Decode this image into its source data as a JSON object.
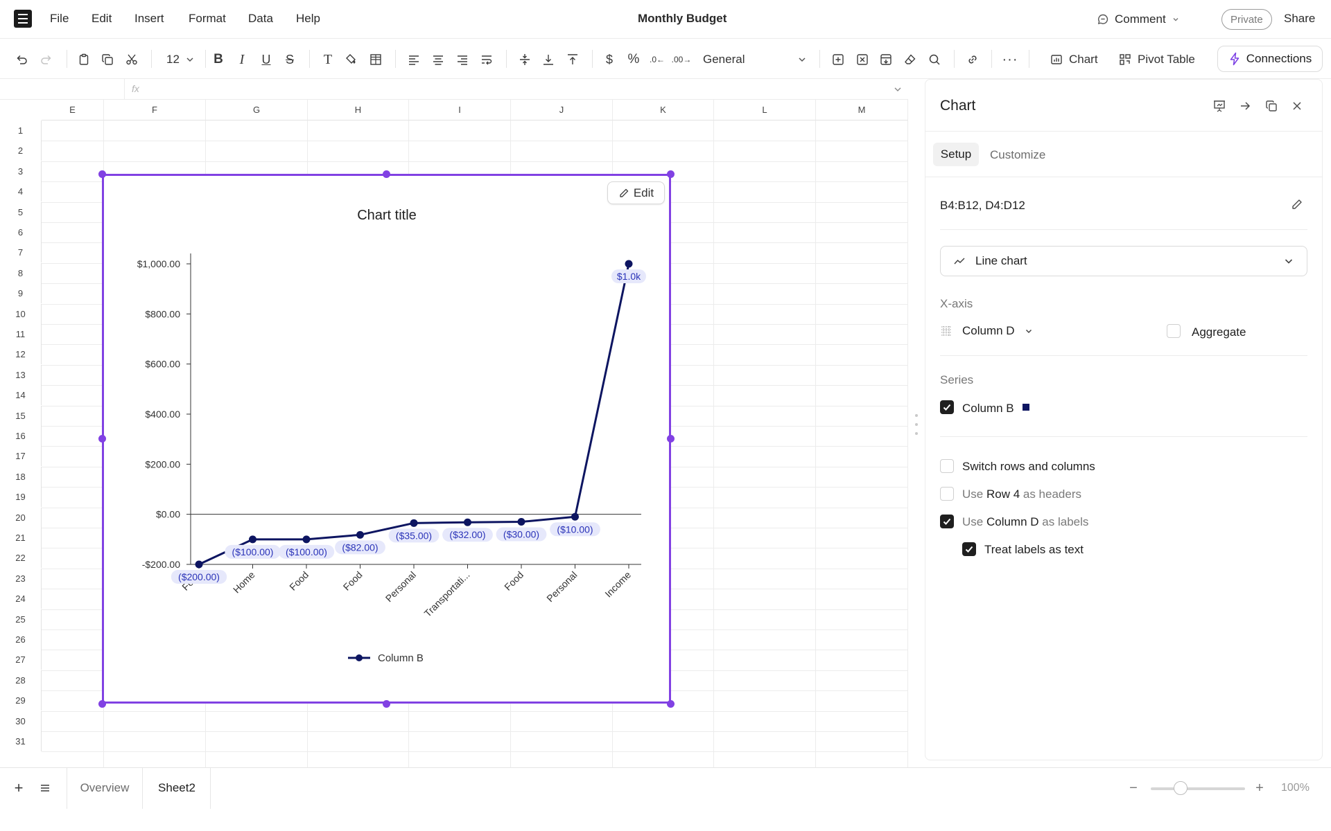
{
  "menu": {
    "items": [
      "File",
      "Edit",
      "Insert",
      "Format",
      "Data",
      "Help"
    ]
  },
  "document": {
    "title": "Monthly Budget"
  },
  "header": {
    "comment_label": "Comment",
    "private_label": "Private",
    "share_label": "Share"
  },
  "toolbar": {
    "font_size": "12",
    "number_format": "General",
    "chart_label": "Chart",
    "pivot_label": "Pivot Table",
    "connections_label": "Connections",
    "icons": [
      "undo-icon",
      "redo-icon",
      "paste-icon",
      "copy-icon",
      "cut-icon",
      "bold-icon",
      "italic-icon",
      "underline-icon",
      "strikethrough-icon",
      "clear-format-icon",
      "fill-color-icon",
      "borders-icon",
      "align-left-icon",
      "align-center-icon",
      "align-right-icon",
      "wrap-icon",
      "valign-middle-icon",
      "valign-bottom-icon",
      "valign-top-icon",
      "currency-icon",
      "percent-icon",
      "decrease-decimal-icon",
      "increase-decimal-icon",
      "insert-icon",
      "delete-icon",
      "freeze-icon",
      "eraser-icon",
      "search-icon",
      "link-icon",
      "more-icon"
    ]
  },
  "formula_bar": {
    "fx": "fx"
  },
  "grid": {
    "columns": [
      "E",
      "F",
      "G",
      "H",
      "I",
      "J",
      "K",
      "L",
      "M"
    ],
    "rows": [
      "1",
      "2",
      "3",
      "4",
      "5",
      "6",
      "7",
      "8",
      "9",
      "10",
      "11",
      "12",
      "13",
      "14",
      "15",
      "16",
      "17",
      "18",
      "19",
      "20",
      "21",
      "22",
      "23",
      "24",
      "25",
      "26",
      "27",
      "28",
      "29",
      "30",
      "31"
    ]
  },
  "chart_edit_label": "Edit",
  "chart_data": {
    "type": "line",
    "title": "Chart title",
    "categories": [
      "Food",
      "Home",
      "Food",
      "Food",
      "Personal",
      "Transportati...",
      "Food",
      "Personal",
      "Income"
    ],
    "series": [
      {
        "name": "Column B",
        "color": "#0d1561",
        "values": [
          -200,
          -100,
          -100,
          -82,
          -35,
          -32,
          -30,
          -10,
          1000
        ]
      }
    ],
    "data_labels": [
      "($200.00)",
      "($100.00)",
      "($100.00)",
      "($82.00)",
      "($35.00)",
      "($32.00)",
      "($30.00)",
      "($10.00)",
      "$1.0k"
    ],
    "y_ticks": [
      "$1,000.00",
      "$800.00",
      "$600.00",
      "$400.00",
      "$200.00",
      "$0.00",
      "-$200.00"
    ],
    "y_tick_values": [
      1000,
      800,
      600,
      400,
      200,
      0,
      -200
    ],
    "ylim": [
      -200,
      1000
    ],
    "xlabel": "",
    "ylabel": "",
    "legend": "bottom",
    "grid": false
  },
  "panel": {
    "title": "Chart",
    "tabs": [
      "Setup",
      "Customize"
    ],
    "range": "B4:B12, D4:D12",
    "chart_type": "Line chart",
    "xaxis_label": "X-axis",
    "xaxis_value": "Column D",
    "aggregate_label": "Aggregate",
    "series_label": "Series",
    "series_item": "Column B",
    "series_color": "#0d1561",
    "options": {
      "switch": "Switch rows and columns",
      "use1_pre": "Use ",
      "use1_bold": "Row 4",
      "use1_post": " as headers",
      "use2_pre": "Use ",
      "use2_bold": "Column D",
      "use2_post": " as labels",
      "treat": "Treat labels as text"
    }
  },
  "sheets": {
    "tabs": [
      "Overview",
      "Sheet2"
    ],
    "active": "Sheet2"
  },
  "zoom": {
    "label": "100%",
    "value": 100
  }
}
